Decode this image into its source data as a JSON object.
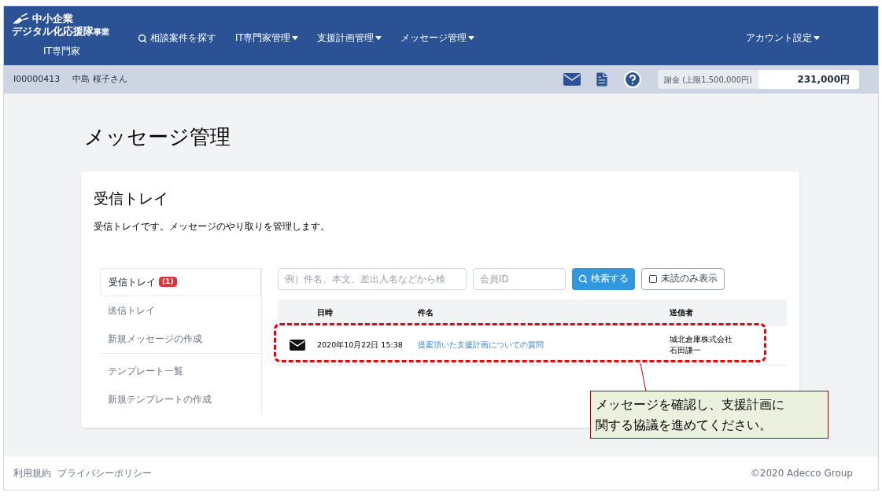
{
  "header": {
    "logo_line1": "中小企業",
    "logo_line2": "デジタル化応援隊",
    "logo_suffix": "事業",
    "role": "IT専門家",
    "nav": [
      {
        "label": "相談案件を探す",
        "kind": "search"
      },
      {
        "label": "IT専門家管理",
        "kind": "dropdown"
      },
      {
        "label": "支援計画管理",
        "kind": "dropdown"
      },
      {
        "label": "メッセージ管理",
        "kind": "dropdown"
      }
    ],
    "account": "アカウント設定"
  },
  "subbar": {
    "user_id": "I00000413",
    "user_name": "中島 桜子さん",
    "fee_label": "謝金 (上限1,500,000円)",
    "fee_value": "231,000円"
  },
  "page_title": "メッセージ管理",
  "card": {
    "title": "受信トレイ",
    "description": "受信トレイです。メッセージのやり取りを管理します。",
    "side_groups": [
      [
        {
          "label": "受信トレイ",
          "badge": "(1)",
          "selected": true
        },
        {
          "label": "送信トレイ",
          "selected": false
        },
        {
          "label": "新規メッセージの作成",
          "selected": false
        }
      ],
      [
        {
          "label": "テンプレート一覧",
          "selected": false
        },
        {
          "label": "新規テンプレートの作成",
          "selected": false
        }
      ]
    ],
    "search": {
      "placeholder": "例）件名、本文、差出人名などから検",
      "member_placeholder": "会員ID",
      "button": "検索する",
      "unread_label": "未読のみ表示",
      "unread_checked": false
    },
    "columns": [
      "日時",
      "件名",
      "送信者"
    ],
    "rows": [
      {
        "unread": true,
        "date": "2020年10月22日 15:38",
        "subject": "提案頂いた支援計画についての質問",
        "sender": [
          "城北倉庫株式会社",
          "石田謙一"
        ]
      }
    ]
  },
  "callout": [
    "メッセージを確認し、支援計画に",
    "関する協議を進めてください。"
  ],
  "footer": {
    "links": [
      "利用規約",
      "プライバシーポリシー"
    ],
    "copyright": "©2020 Adecco Group"
  }
}
